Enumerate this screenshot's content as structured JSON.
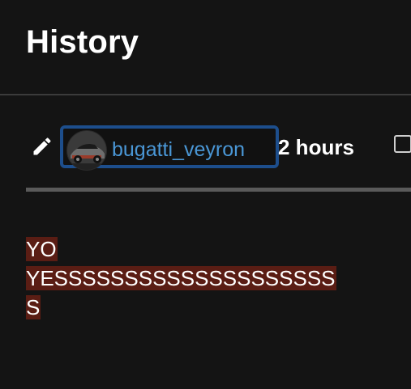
{
  "header": {
    "title": "History"
  },
  "entry": {
    "username": "bugatti_veyron",
    "timestamp": "2 hours",
    "edit_icon": "pencil-icon",
    "avatar_icon": "car-avatar"
  },
  "diff": {
    "lines": [
      "YO",
      "YESSSSSSSSSSSSSSSSSSSS",
      "S"
    ],
    "highlight_color": "#5a1d14"
  },
  "colors": {
    "background": "#141414",
    "username_link": "#4a97d6",
    "chip_border": "#1d4e8c"
  }
}
